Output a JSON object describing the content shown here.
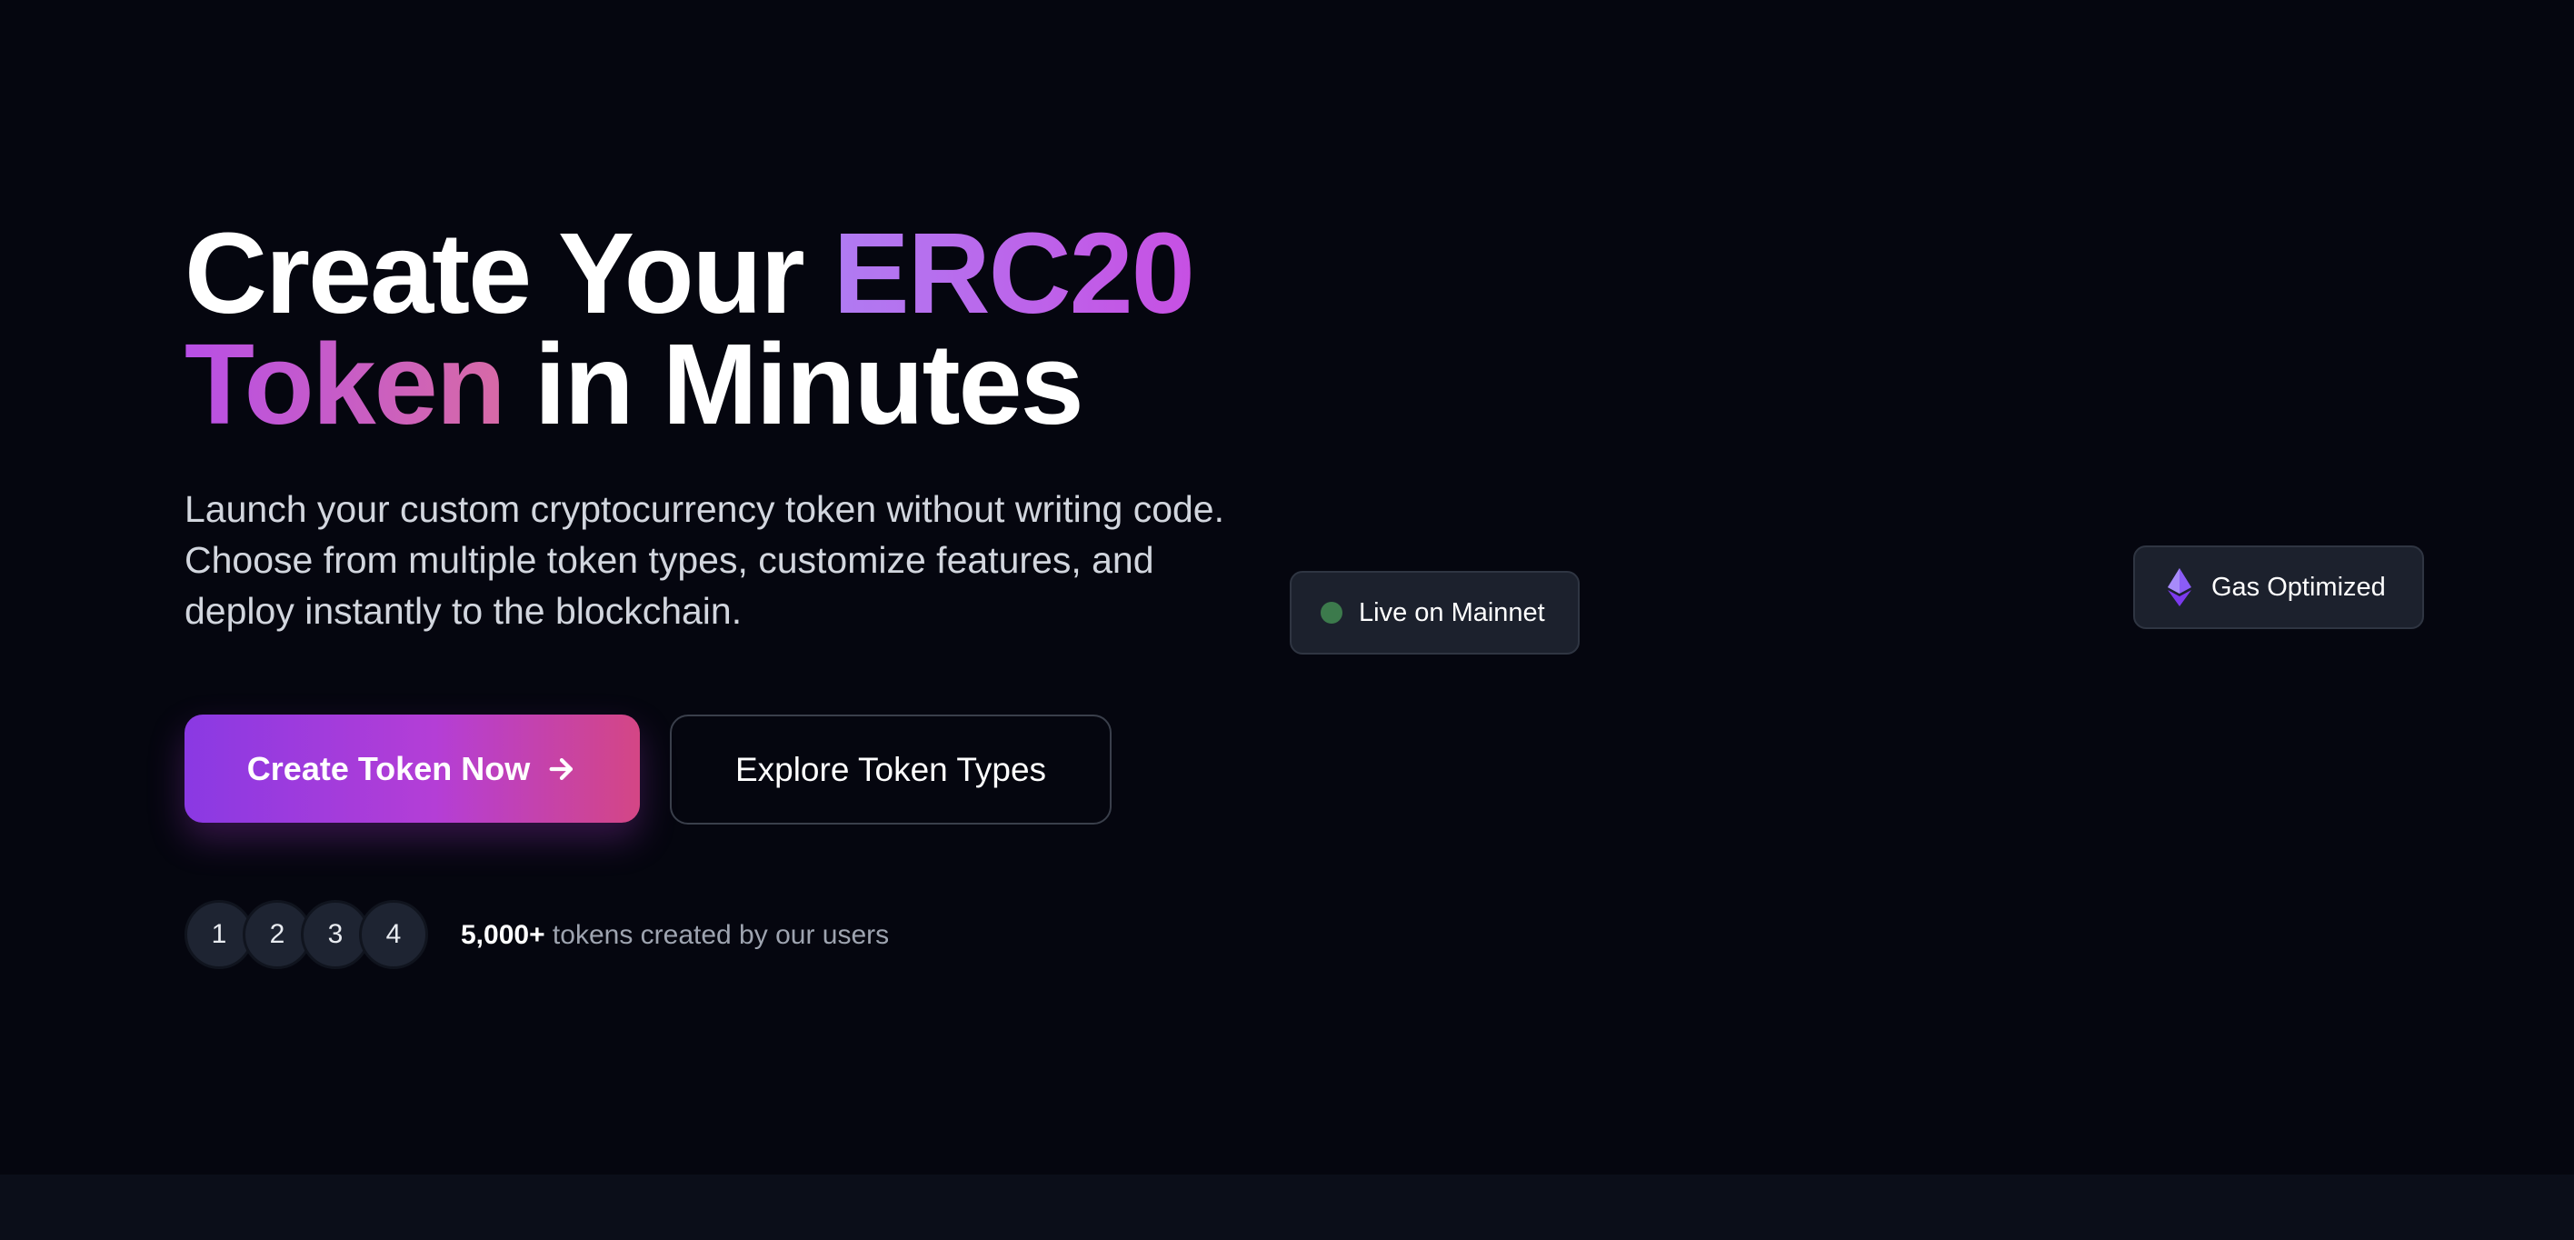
{
  "hero": {
    "headline": {
      "part1": "Create Your ",
      "part2": "ERC20",
      "part3": "Token",
      "part4": " in Minutes"
    },
    "subtitle": "Launch your custom cryptocurrency token without writing code. Choose from multiple token types, customize features, and deploy instantly to the blockchain.",
    "primary_button": {
      "label": "Create Token Now",
      "icon": "arrow-right-icon"
    },
    "secondary_button": {
      "label": "Explore Token Types"
    },
    "avatars": [
      "1",
      "2",
      "3",
      "4"
    ],
    "stats": {
      "count": "5,000+",
      "text": " tokens created by our users"
    }
  },
  "badges": {
    "mainnet": {
      "label": "Live on Mainnet",
      "icon": "status-dot-icon",
      "dot_color": "#3c7a4c"
    },
    "gas": {
      "label": "Gas Optimized",
      "icon": "ethereum-icon",
      "icon_color": "#8b5cf6"
    }
  },
  "colors": {
    "background": "#05060f",
    "footer_band": "#0b0e19",
    "gradient_start": "#8a39e3",
    "gradient_end": "#d44685"
  }
}
